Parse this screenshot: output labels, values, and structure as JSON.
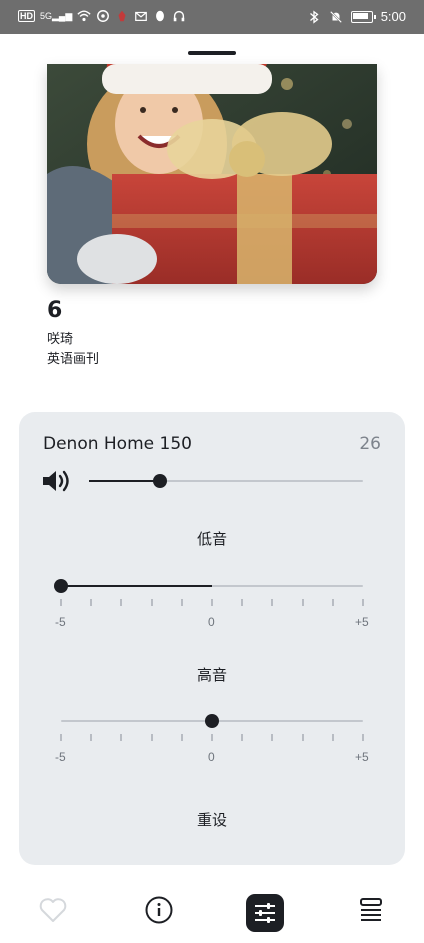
{
  "status_bar": {
    "left_icons": [
      "hd-icon",
      "signal-icon",
      "wifi-icon",
      "app-icon",
      "notification-icon",
      "mail-icon",
      "qq-icon",
      "headphones-icon"
    ],
    "hd_text": "HD",
    "network_text": "5G",
    "right_icons": [
      "bluetooth-icon",
      "mute-icon",
      "battery-icon"
    ],
    "time": "5:00"
  },
  "now_playing": {
    "artwork": "photo of a girl in a santa hat holding a wrapped gift",
    "track_number": "6",
    "title": "咲琦",
    "album": "英语画刊"
  },
  "device_panel": {
    "device_name": "Denon Home 150",
    "volume_value": "26",
    "volume_level": 0.26,
    "bass": {
      "label": "低音",
      "value": -5,
      "min_label": "-5",
      "mid_label": "0",
      "max_label": "+5"
    },
    "treble": {
      "label": "高音",
      "value": 0,
      "min_label": "-5",
      "mid_label": "0",
      "max_label": "+5"
    },
    "reset_label": "重设"
  },
  "bottom_nav": {
    "items": [
      "favorite-icon",
      "info-icon",
      "equalizer-icon",
      "queue-icon"
    ],
    "active": "equalizer-icon"
  },
  "colors": {
    "accent": "#1d1f24",
    "panel_bg": "#e9ecef",
    "status_bar_bg": "#6e6e6e",
    "muted_text": "#7d838c"
  }
}
